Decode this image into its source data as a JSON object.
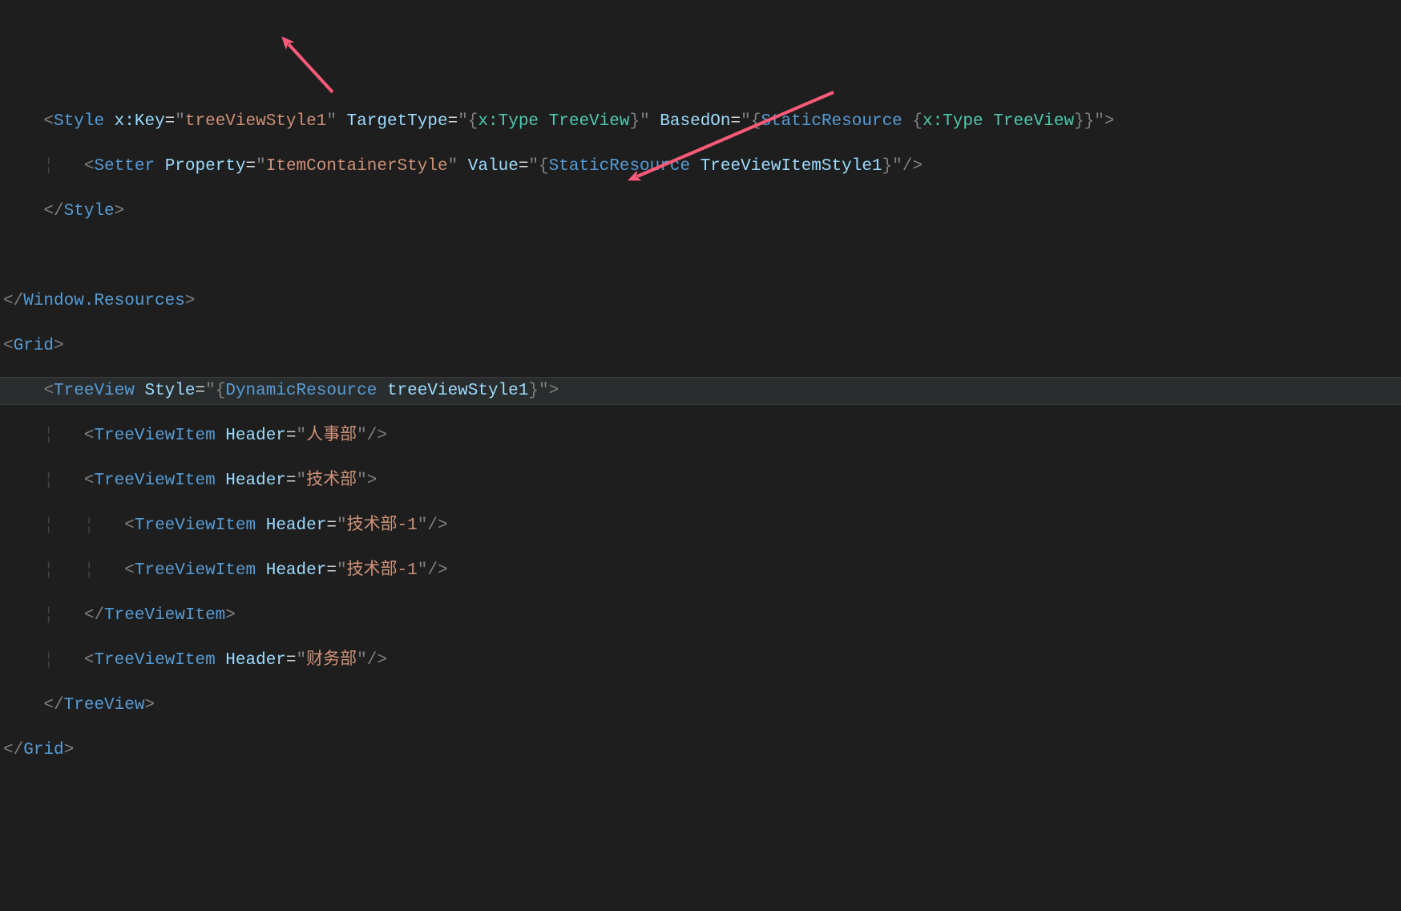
{
  "code": {
    "l1": {
      "tag": "Style",
      "attr1": "x:Key",
      "val1": "treeViewStyle1",
      "attr2": "TargetType",
      "brace_open": "{",
      "kw_xType": "x:Type",
      "cls1": "TreeView",
      "brace_close": "}",
      "attr3": "BasedOn",
      "kw_static": "StaticResource",
      "kw_xType2": "x:Type",
      "cls2": "TreeView"
    },
    "l2": {
      "tag": "Setter",
      "attr1": "Property",
      "val1": "ItemContainerStyle",
      "attr2": "Value",
      "kw_static": "StaticResource",
      "ref": "TreeViewItemStyle1"
    },
    "l3": {
      "tag": "Style"
    },
    "l4": {
      "tag": "Window.Resources"
    },
    "l5": {
      "tag": "Grid"
    },
    "l6": {
      "tag": "TreeView",
      "attr1": "Style",
      "kw_dyn": "DynamicResource",
      "ref": "treeViewStyle1"
    },
    "l7": {
      "tag": "TreeViewItem",
      "attr": "Header",
      "val": "人事部"
    },
    "l8": {
      "tag": "TreeViewItem",
      "attr": "Header",
      "val": "技术部"
    },
    "l9": {
      "tag": "TreeViewItem",
      "attr": "Header",
      "val": "技术部-1"
    },
    "l10": {
      "tag": "TreeViewItem",
      "attr": "Header",
      "val": "技术部-1"
    },
    "l11": {
      "tag": "TreeViewItem"
    },
    "l12": {
      "tag": "TreeViewItem",
      "attr": "Header",
      "val": "财务部"
    },
    "l13": {
      "tag": "TreeView"
    },
    "l14": {
      "tag": "Grid"
    }
  },
  "colors": {
    "arrow": "#ff5a7a"
  }
}
